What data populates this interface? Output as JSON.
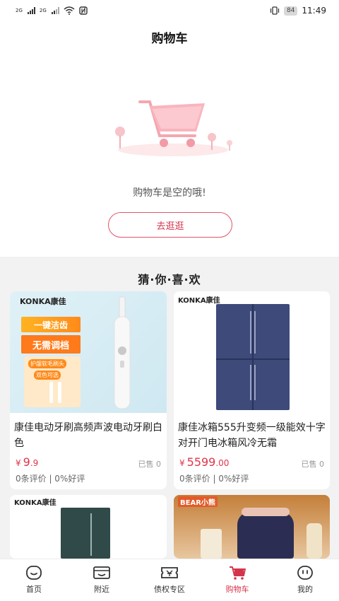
{
  "status": {
    "sim1": "2G",
    "sim2": "2G",
    "battery": "84",
    "time": "11:49"
  },
  "nav": {
    "title": "购物车"
  },
  "empty": {
    "message": "购物车是空的哦!",
    "button_label": "去逛逛"
  },
  "recommend": {
    "title": "猜·你·喜·欢",
    "products": [
      {
        "brand": "KONKA康佳",
        "name": "康佳电动牙刷高频声波电动牙刷白色",
        "price_int": "9",
        "price_dec": ".9",
        "sold": "已售 0",
        "review": "0条评价 | 0%好评",
        "badge_top": "一键洁齿",
        "badge_mid": "无需调档",
        "badge_small1": "护龈软毛刷头",
        "badge_small2": "双色可选"
      },
      {
        "brand": "KONKA康佳",
        "name": "康佳冰箱555升变频一级能效十字对开门电冰箱风冷无霜",
        "price_int": "5599",
        "price_dec": ".00",
        "sold": "已售 0",
        "review": "0条评价 | 0%好评"
      },
      {
        "brand": "KONKA康佳"
      },
      {
        "brand": "BEAR小熊"
      }
    ]
  },
  "tabs": [
    {
      "label": "首页",
      "icon": "home-face-icon"
    },
    {
      "label": "附近",
      "icon": "nearby-icon"
    },
    {
      "label": "债权专区",
      "icon": "ticket-icon"
    },
    {
      "label": "购物车",
      "icon": "cart-icon"
    },
    {
      "label": "我的",
      "icon": "profile-icon"
    }
  ],
  "colors": {
    "accent": "#d4344b",
    "background_reco": "#f2f2f2"
  },
  "currency_symbol": "¥"
}
